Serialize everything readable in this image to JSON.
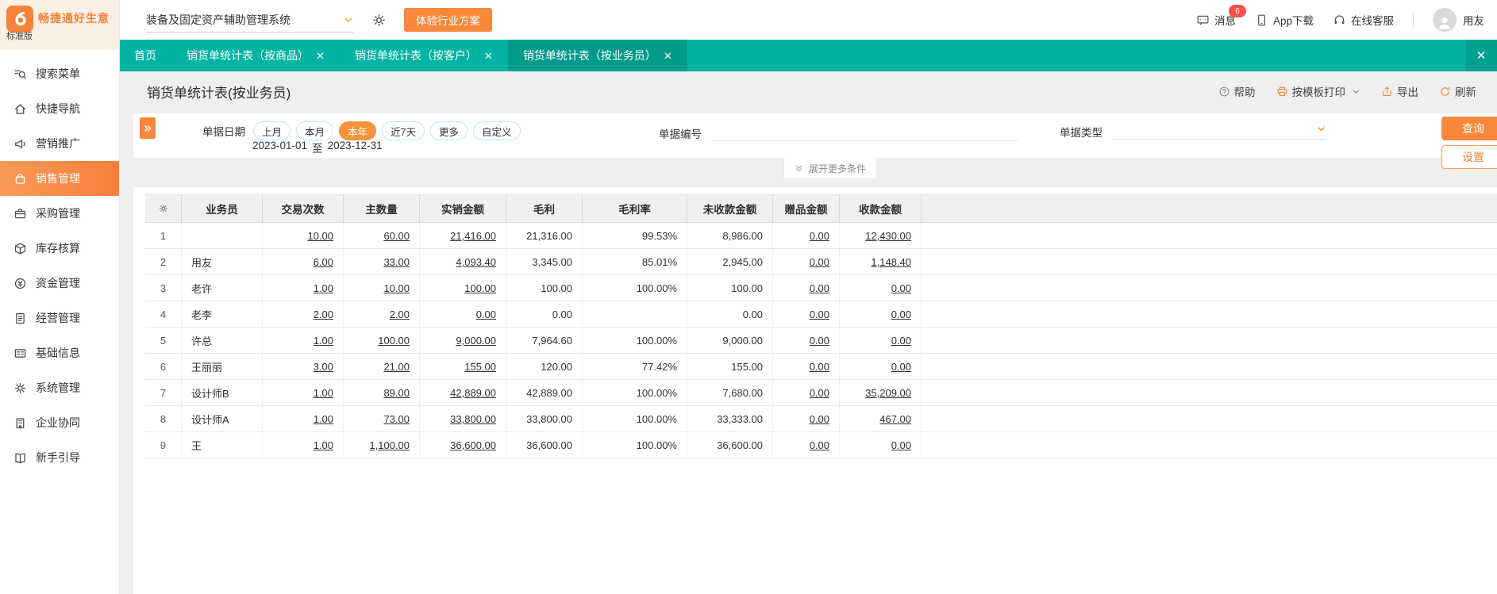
{
  "theme": {
    "teal": "#00b3a3",
    "teal_dark": "#009a8b",
    "orange": "#f7883c",
    "pill_selected": "#f7923e",
    "badge_red": "#f8504a"
  },
  "brand": {
    "name": "畅捷通好生意",
    "edition": "标准版"
  },
  "topbar": {
    "system_select": "装备及固定资产辅助管理系统",
    "trial_button": "体验行业方案",
    "message": "消息",
    "message_badge": "6",
    "app_download": "App下载",
    "online_service": "在线客服",
    "user": "用友"
  },
  "sidebar": {
    "items": [
      {
        "id": "search-menu",
        "label": "搜索菜单",
        "icon": "search-menu",
        "active": false
      },
      {
        "id": "quick-nav",
        "label": "快捷导航",
        "icon": "quick-nav",
        "active": false
      },
      {
        "id": "marketing",
        "label": "营销推广",
        "icon": "marketing",
        "active": false
      },
      {
        "id": "sales",
        "label": "销售管理",
        "icon": "sales",
        "active": true
      },
      {
        "id": "purchase",
        "label": "采购管理",
        "icon": "purchase",
        "active": false
      },
      {
        "id": "inventory",
        "label": "库存核算",
        "icon": "inventory",
        "active": false
      },
      {
        "id": "funds",
        "label": "资金管理",
        "icon": "funds",
        "active": false
      },
      {
        "id": "operations",
        "label": "经营管理",
        "icon": "operations",
        "active": false
      },
      {
        "id": "base-info",
        "label": "基础信息",
        "icon": "base-info",
        "active": false
      },
      {
        "id": "system",
        "label": "系统管理",
        "icon": "system",
        "active": false
      },
      {
        "id": "collaboration",
        "label": "企业协同",
        "icon": "collaboration",
        "active": false
      },
      {
        "id": "guide",
        "label": "新手引导",
        "icon": "guide",
        "active": false
      }
    ]
  },
  "tabs": [
    {
      "id": "home",
      "label": "首页",
      "closable": false,
      "active": false
    },
    {
      "id": "by-product",
      "label": "销货单统计表（按商品）",
      "closable": true,
      "active": false
    },
    {
      "id": "by-customer",
      "label": "销货单统计表（按客户）",
      "closable": true,
      "active": false
    },
    {
      "id": "by-salesman",
      "label": "销货单统计表（按业务员）",
      "closable": true,
      "active": true
    }
  ],
  "page": {
    "title": "销货单统计表(按业务员)",
    "actions": {
      "help": "帮助",
      "print": "按模板打印",
      "export": "导出",
      "refresh": "刷新"
    }
  },
  "filters": {
    "date_label": "单据日期",
    "date_pills": [
      "上月",
      "本月",
      "本年",
      "近7天",
      "更多",
      "自定义"
    ],
    "date_pill_selected": "本年",
    "date_range": {
      "start": "2023-01-01",
      "separator": "至",
      "end": "2023-12-31"
    },
    "doc_no_label": "单据编号",
    "doc_no_value": "",
    "doc_type_label": "单据类型",
    "doc_type_value": "",
    "search_button": "查询",
    "settings_button": "设置",
    "expand_more": "展开更多条件"
  },
  "table": {
    "columns": [
      "业务员",
      "交易次数",
      "主数量",
      "实销金额",
      "毛利",
      "毛利率",
      "未收款金额",
      "赠品金额",
      "收款金额"
    ],
    "rows": [
      {
        "num": "1",
        "name": "",
        "trades": "10.00",
        "qty": "60.00",
        "sales": "21,416.00",
        "profit": "21,316.00",
        "margin": "99.53%",
        "unpaid": "8,986.00",
        "gift": "0.00",
        "received": "12,430.00"
      },
      {
        "num": "2",
        "name": "用友",
        "trades": "6.00",
        "qty": "33.00",
        "sales": "4,093.40",
        "profit": "3,345.00",
        "margin": "85.01%",
        "unpaid": "2,945.00",
        "gift": "0.00",
        "received": "1,148.40"
      },
      {
        "num": "3",
        "name": "老许",
        "trades": "1.00",
        "qty": "10.00",
        "sales": "100.00",
        "profit": "100.00",
        "margin": "100.00%",
        "unpaid": "100.00",
        "gift": "0.00",
        "received": "0.00"
      },
      {
        "num": "4",
        "name": "老李",
        "trades": "2.00",
        "qty": "2.00",
        "sales": "0.00",
        "profit": "0.00",
        "margin": "",
        "unpaid": "0.00",
        "gift": "0.00",
        "received": "0.00"
      },
      {
        "num": "5",
        "name": "许总",
        "trades": "1.00",
        "qty": "100.00",
        "sales": "9,000.00",
        "profit": "7,964.60",
        "margin": "100.00%",
        "unpaid": "9,000.00",
        "gift": "0.00",
        "received": "0.00"
      },
      {
        "num": "6",
        "name": "王丽丽",
        "trades": "3.00",
        "qty": "21.00",
        "sales": "155.00",
        "profit": "120.00",
        "margin": "77.42%",
        "unpaid": "155.00",
        "gift": "0.00",
        "received": "0.00"
      },
      {
        "num": "7",
        "name": "设计师B",
        "trades": "1.00",
        "qty": "89.00",
        "sales": "42,889.00",
        "profit": "42,889.00",
        "margin": "100.00%",
        "unpaid": "7,680.00",
        "gift": "0.00",
        "received": "35,209.00"
      },
      {
        "num": "8",
        "name": "设计师A",
        "trades": "1.00",
        "qty": "73.00",
        "sales": "33,800.00",
        "profit": "33,800.00",
        "margin": "100.00%",
        "unpaid": "33,333.00",
        "gift": "0.00",
        "received": "467.00"
      },
      {
        "num": "9",
        "name": "王",
        "trades": "1.00",
        "qty": "1,100.00",
        "sales": "36,600.00",
        "profit": "36,600.00",
        "margin": "100.00%",
        "unpaid": "36,600.00",
        "gift": "0.00",
        "received": "0.00"
      }
    ]
  }
}
